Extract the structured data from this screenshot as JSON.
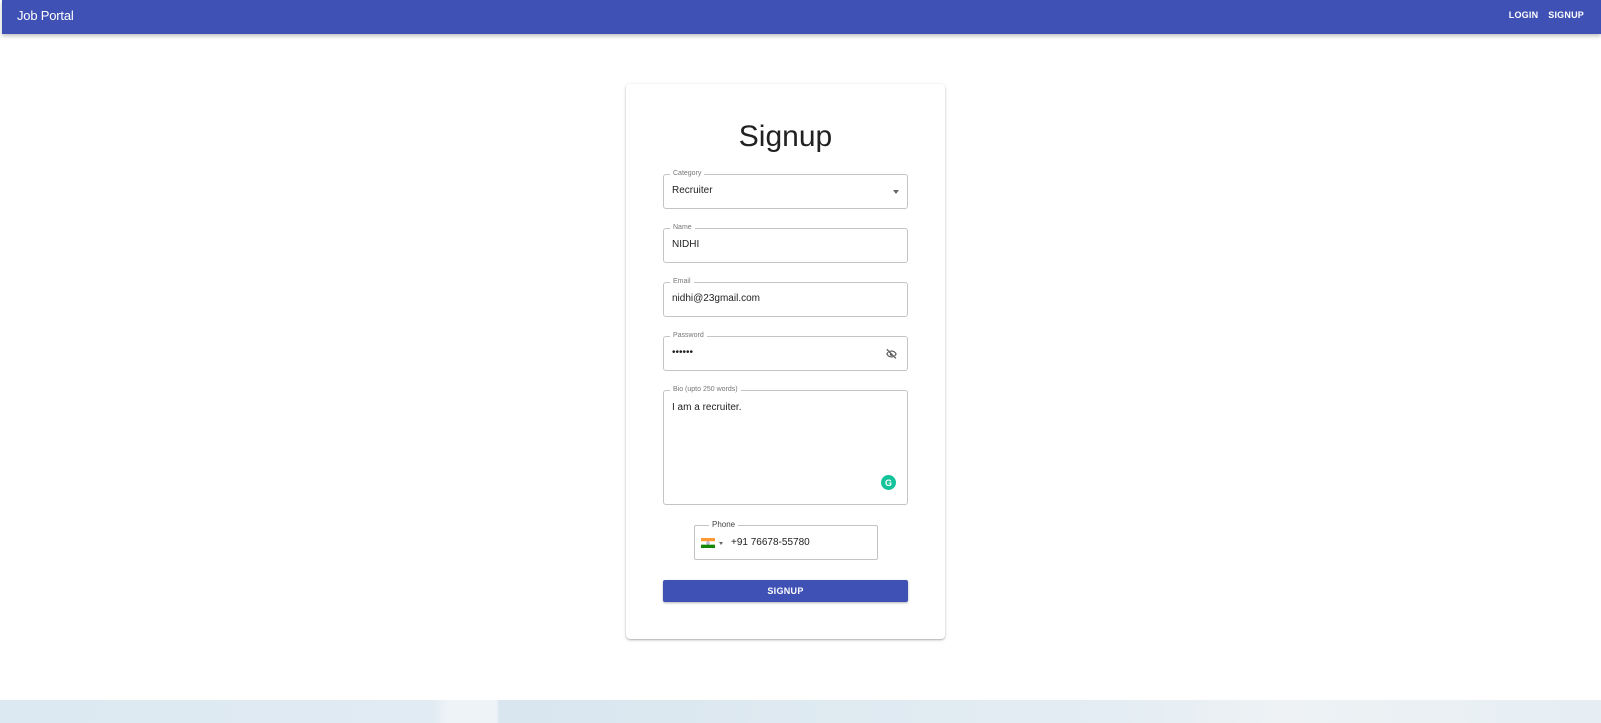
{
  "appbar": {
    "brand": "Job Portal",
    "nav": {
      "login": "LOGIN",
      "signup": "SIGNUP"
    },
    "color": "#3f51b5"
  },
  "form": {
    "title": "Signup",
    "category": {
      "label": "Category",
      "value": "Recruiter"
    },
    "name": {
      "label": "Name",
      "value": "NIDHI"
    },
    "email": {
      "label": "Email",
      "value": "nidhi@23gmail.com"
    },
    "password": {
      "label": "Password",
      "value": "••••••"
    },
    "bio": {
      "label": "Bio (upto 250 words)",
      "value": "I am a recruiter."
    },
    "phone": {
      "label": "Phone",
      "value": "+91 76678-55780",
      "flag": "india-flag-icon"
    },
    "submit_label": "SIGNUP"
  },
  "icons": {
    "password_toggle": "eye-off-icon",
    "grammarly": "grammarly-icon",
    "category_dropdown": "caret-down-icon"
  }
}
